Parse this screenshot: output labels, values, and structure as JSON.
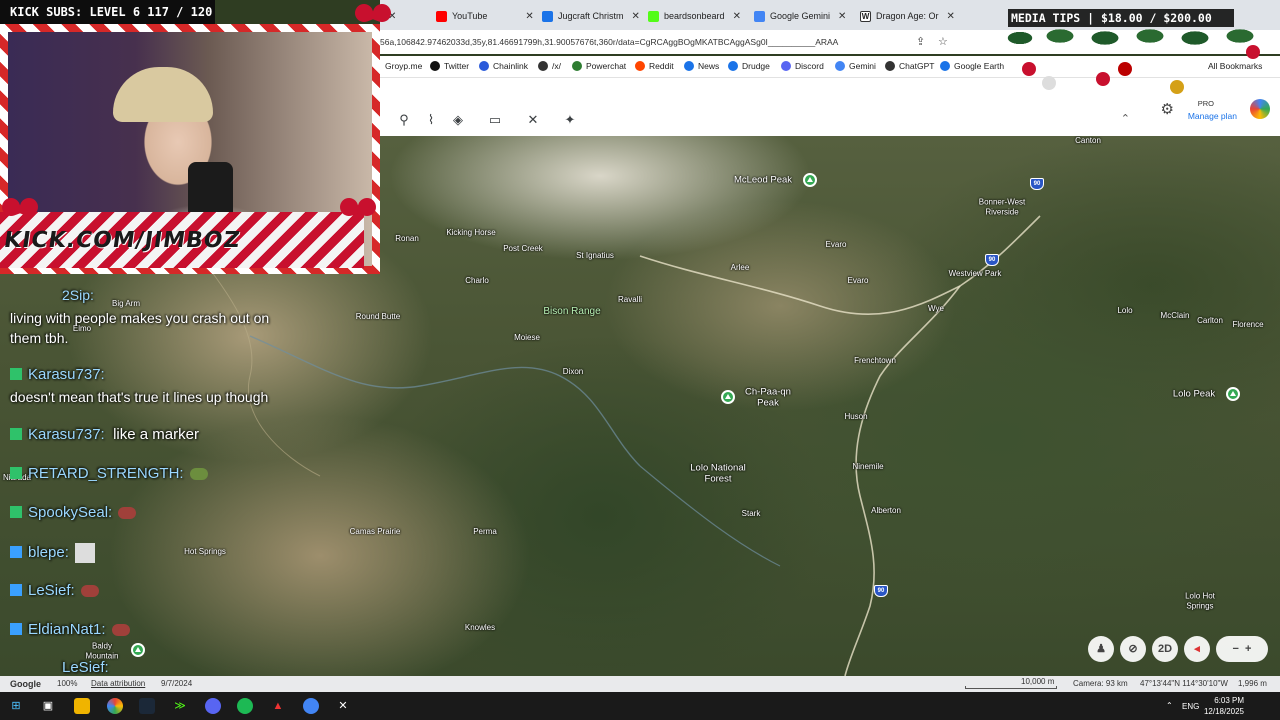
{
  "overlay": {
    "subs_text": "KICK SUBS: LEVEL 6 117 / 120",
    "kick_url": "KICK.COM/JIMBOZ",
    "media_tips": "MEDIA TIPS | $18.00 / $200.00"
  },
  "browser": {
    "tabs": [
      {
        "label": "YouTube",
        "color": "#ff0000"
      },
      {
        "label": "Jugcraft Christm",
        "color": "#1a73e8"
      },
      {
        "label": "beardsonbeard",
        "color": "#53fc18"
      },
      {
        "label": "Google Gemini",
        "color": "#4285f4"
      },
      {
        "label": "Dragon Age: Or",
        "color": "#333333"
      }
    ],
    "url": "56a,106842.97462033d,35y,81.46691799h,31.90057676t,360r/data=CgRCAggBOgMKATBCAggASg0I__________ARAA",
    "bookmarks": [
      "Groyp.me",
      "Twitter",
      "Chainlink",
      "/x/",
      "Powerchat",
      "Reddit",
      "News",
      "Drudge",
      "Discord",
      "Gemini",
      "ChatGPT",
      "Google Earth"
    ],
    "all_bookmarks": "All Bookmarks",
    "pro_label": "PRO",
    "manage_plan": "Manage plan"
  },
  "map": {
    "places": [
      {
        "name": "McLeod Peak",
        "kind": "peak"
      },
      {
        "name": "Bonner-West\nRiverside",
        "kind": "town"
      },
      {
        "name": "Ronan",
        "kind": "town"
      },
      {
        "name": "Kicking Horse",
        "kind": "town"
      },
      {
        "name": "Post Creek",
        "kind": "town"
      },
      {
        "name": "St Ignatius",
        "kind": "town"
      },
      {
        "name": "Evaro",
        "kind": "town"
      },
      {
        "name": "Evaro",
        "kind": "town"
      },
      {
        "name": "Westview Park",
        "kind": "town"
      },
      {
        "name": "Charlo",
        "kind": "town"
      },
      {
        "name": "Arlee",
        "kind": "town"
      },
      {
        "name": "Big Arm",
        "kind": "town"
      },
      {
        "name": "Elmo",
        "kind": "town"
      },
      {
        "name": "Round Butte",
        "kind": "town"
      },
      {
        "name": "Bison Range",
        "kind": "park"
      },
      {
        "name": "Ravalli",
        "kind": "town"
      },
      {
        "name": "Wye",
        "kind": "town"
      },
      {
        "name": "Lolo",
        "kind": "town"
      },
      {
        "name": "McClain",
        "kind": "town"
      },
      {
        "name": "Carlton",
        "kind": "town"
      },
      {
        "name": "Florence",
        "kind": "town"
      },
      {
        "name": "Moiese",
        "kind": "town"
      },
      {
        "name": "Frenchtown",
        "kind": "town"
      },
      {
        "name": "Dixon",
        "kind": "town"
      },
      {
        "name": "Ch-Paa-qn\nPeak",
        "kind": "peak"
      },
      {
        "name": "Lolo Peak",
        "kind": "peak"
      },
      {
        "name": "Huson",
        "kind": "town"
      },
      {
        "name": "Lolo National\nForest",
        "kind": "forest"
      },
      {
        "name": "Ninemile",
        "kind": "town"
      },
      {
        "name": "Niarada",
        "kind": "town"
      },
      {
        "name": "Alberton",
        "kind": "town"
      },
      {
        "name": "Stark",
        "kind": "town"
      },
      {
        "name": "Camas Prairie",
        "kind": "town"
      },
      {
        "name": "Perma",
        "kind": "town"
      },
      {
        "name": "Hot Springs",
        "kind": "town"
      },
      {
        "name": "Lolo Hot\nSprings",
        "kind": "town"
      },
      {
        "name": "Knowles",
        "kind": "town"
      },
      {
        "name": "Baldy\nMountain",
        "kind": "peak"
      },
      {
        "name": "Canton",
        "kind": "town"
      }
    ],
    "shields": [
      "90",
      "90",
      "90"
    ],
    "controls": [
      "pegman-icon",
      "no-tilt-icon",
      "2D",
      "compass-icon",
      "zoom-controls"
    ],
    "scale_label": "10,000 m",
    "camera": "Camera: 93 km",
    "coords": "47°13'44\"N 114°30'10\"W",
    "elevation": "1,996 m"
  },
  "status": {
    "google": "Google",
    "zoom": "100%",
    "attribution": "Data attribution",
    "date": "9/7/2024"
  },
  "chat": [
    {
      "user": "",
      "text": "living with people makes you crash out on"
    },
    {
      "user": "",
      "text": "them tbh."
    },
    {
      "user": "Karasu737:",
      "text": ""
    },
    {
      "user": "",
      "text": "doesn't mean that's true it lines up though"
    },
    {
      "user": "Karasu737:",
      "text": "like a marker"
    },
    {
      "user": "RETARD_STRENGTH:",
      "text": ""
    },
    {
      "user": "SpookySeal:",
      "text": ""
    },
    {
      "user": "blepe:",
      "text": ""
    },
    {
      "user": "LeSief:",
      "text": ""
    },
    {
      "user": "EldianNat1:",
      "text": ""
    },
    {
      "user": "LeSief:",
      "text": ""
    },
    {
      "user": "2Sip:",
      "text": ""
    }
  ],
  "taskbar": {
    "lang": "ENG",
    "time": "6:03 PM",
    "date": "12/18/2025"
  }
}
